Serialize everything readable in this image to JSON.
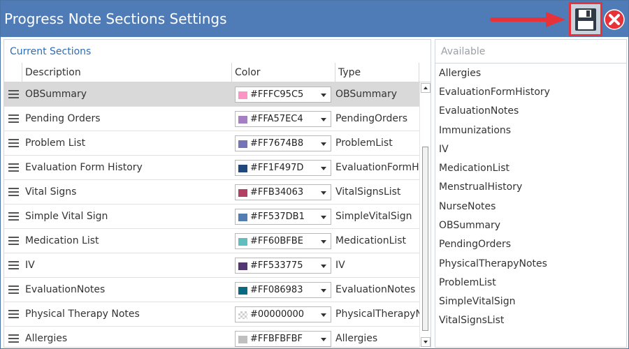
{
  "window": {
    "title": "Progress Note Sections Settings"
  },
  "current_sections": {
    "title": "Current Sections",
    "columns": [
      "Description",
      "Color",
      "Type"
    ],
    "rows": [
      {
        "description": "OBSummary",
        "color": "#FFFC95C5",
        "type": "OBSummary"
      },
      {
        "description": "Pending Orders",
        "color": "#FFA57EC4",
        "type": "PendingOrders"
      },
      {
        "description": "Problem List",
        "color": "#FF7674B8",
        "type": "ProblemList"
      },
      {
        "description": "Evaluation Form History",
        "color": "#FF1F497D",
        "type": "EvaluationFormHistory"
      },
      {
        "description": "Vital Signs",
        "color": "#FFB34063",
        "type": "VitalSignsList"
      },
      {
        "description": "Simple Vital Sign",
        "color": "#FF537DB1",
        "type": "SimpleVitalSign"
      },
      {
        "description": "Medication List",
        "color": "#FF60BFBE",
        "type": "MedicationList"
      },
      {
        "description": "IV",
        "color": "#FF533775",
        "type": "IV"
      },
      {
        "description": "EvaluationNotes",
        "color": "#FF086983",
        "type": "EvaluationNotes"
      },
      {
        "description": "Physical Therapy Notes",
        "color": "#00000000",
        "type": "PhysicalTherapyNotes"
      },
      {
        "description": "Allergies",
        "color": "#FFBFBFBF",
        "type": "Allergies"
      }
    ]
  },
  "available": {
    "title": "Available",
    "items": [
      "Allergies",
      "EvaluationFormHistory",
      "EvaluationNotes",
      "Immunizations",
      "IV",
      "MedicationList",
      "MenstrualHistory",
      "NurseNotes",
      "OBSummary",
      "PendingOrders",
      "PhysicalTherapyNotes",
      "ProblemList",
      "SimpleVitalSign",
      "VitalSignsList"
    ]
  },
  "icons": {
    "save": "floppy-disk-icon",
    "close": "close-circle-icon",
    "pointer": "red-arrow-icon",
    "drag": "drag-handle-icon"
  },
  "colors": {
    "titlebar": "#4f7cb7",
    "accent_red": "#e8323a",
    "section_title": "#2f6db3"
  }
}
